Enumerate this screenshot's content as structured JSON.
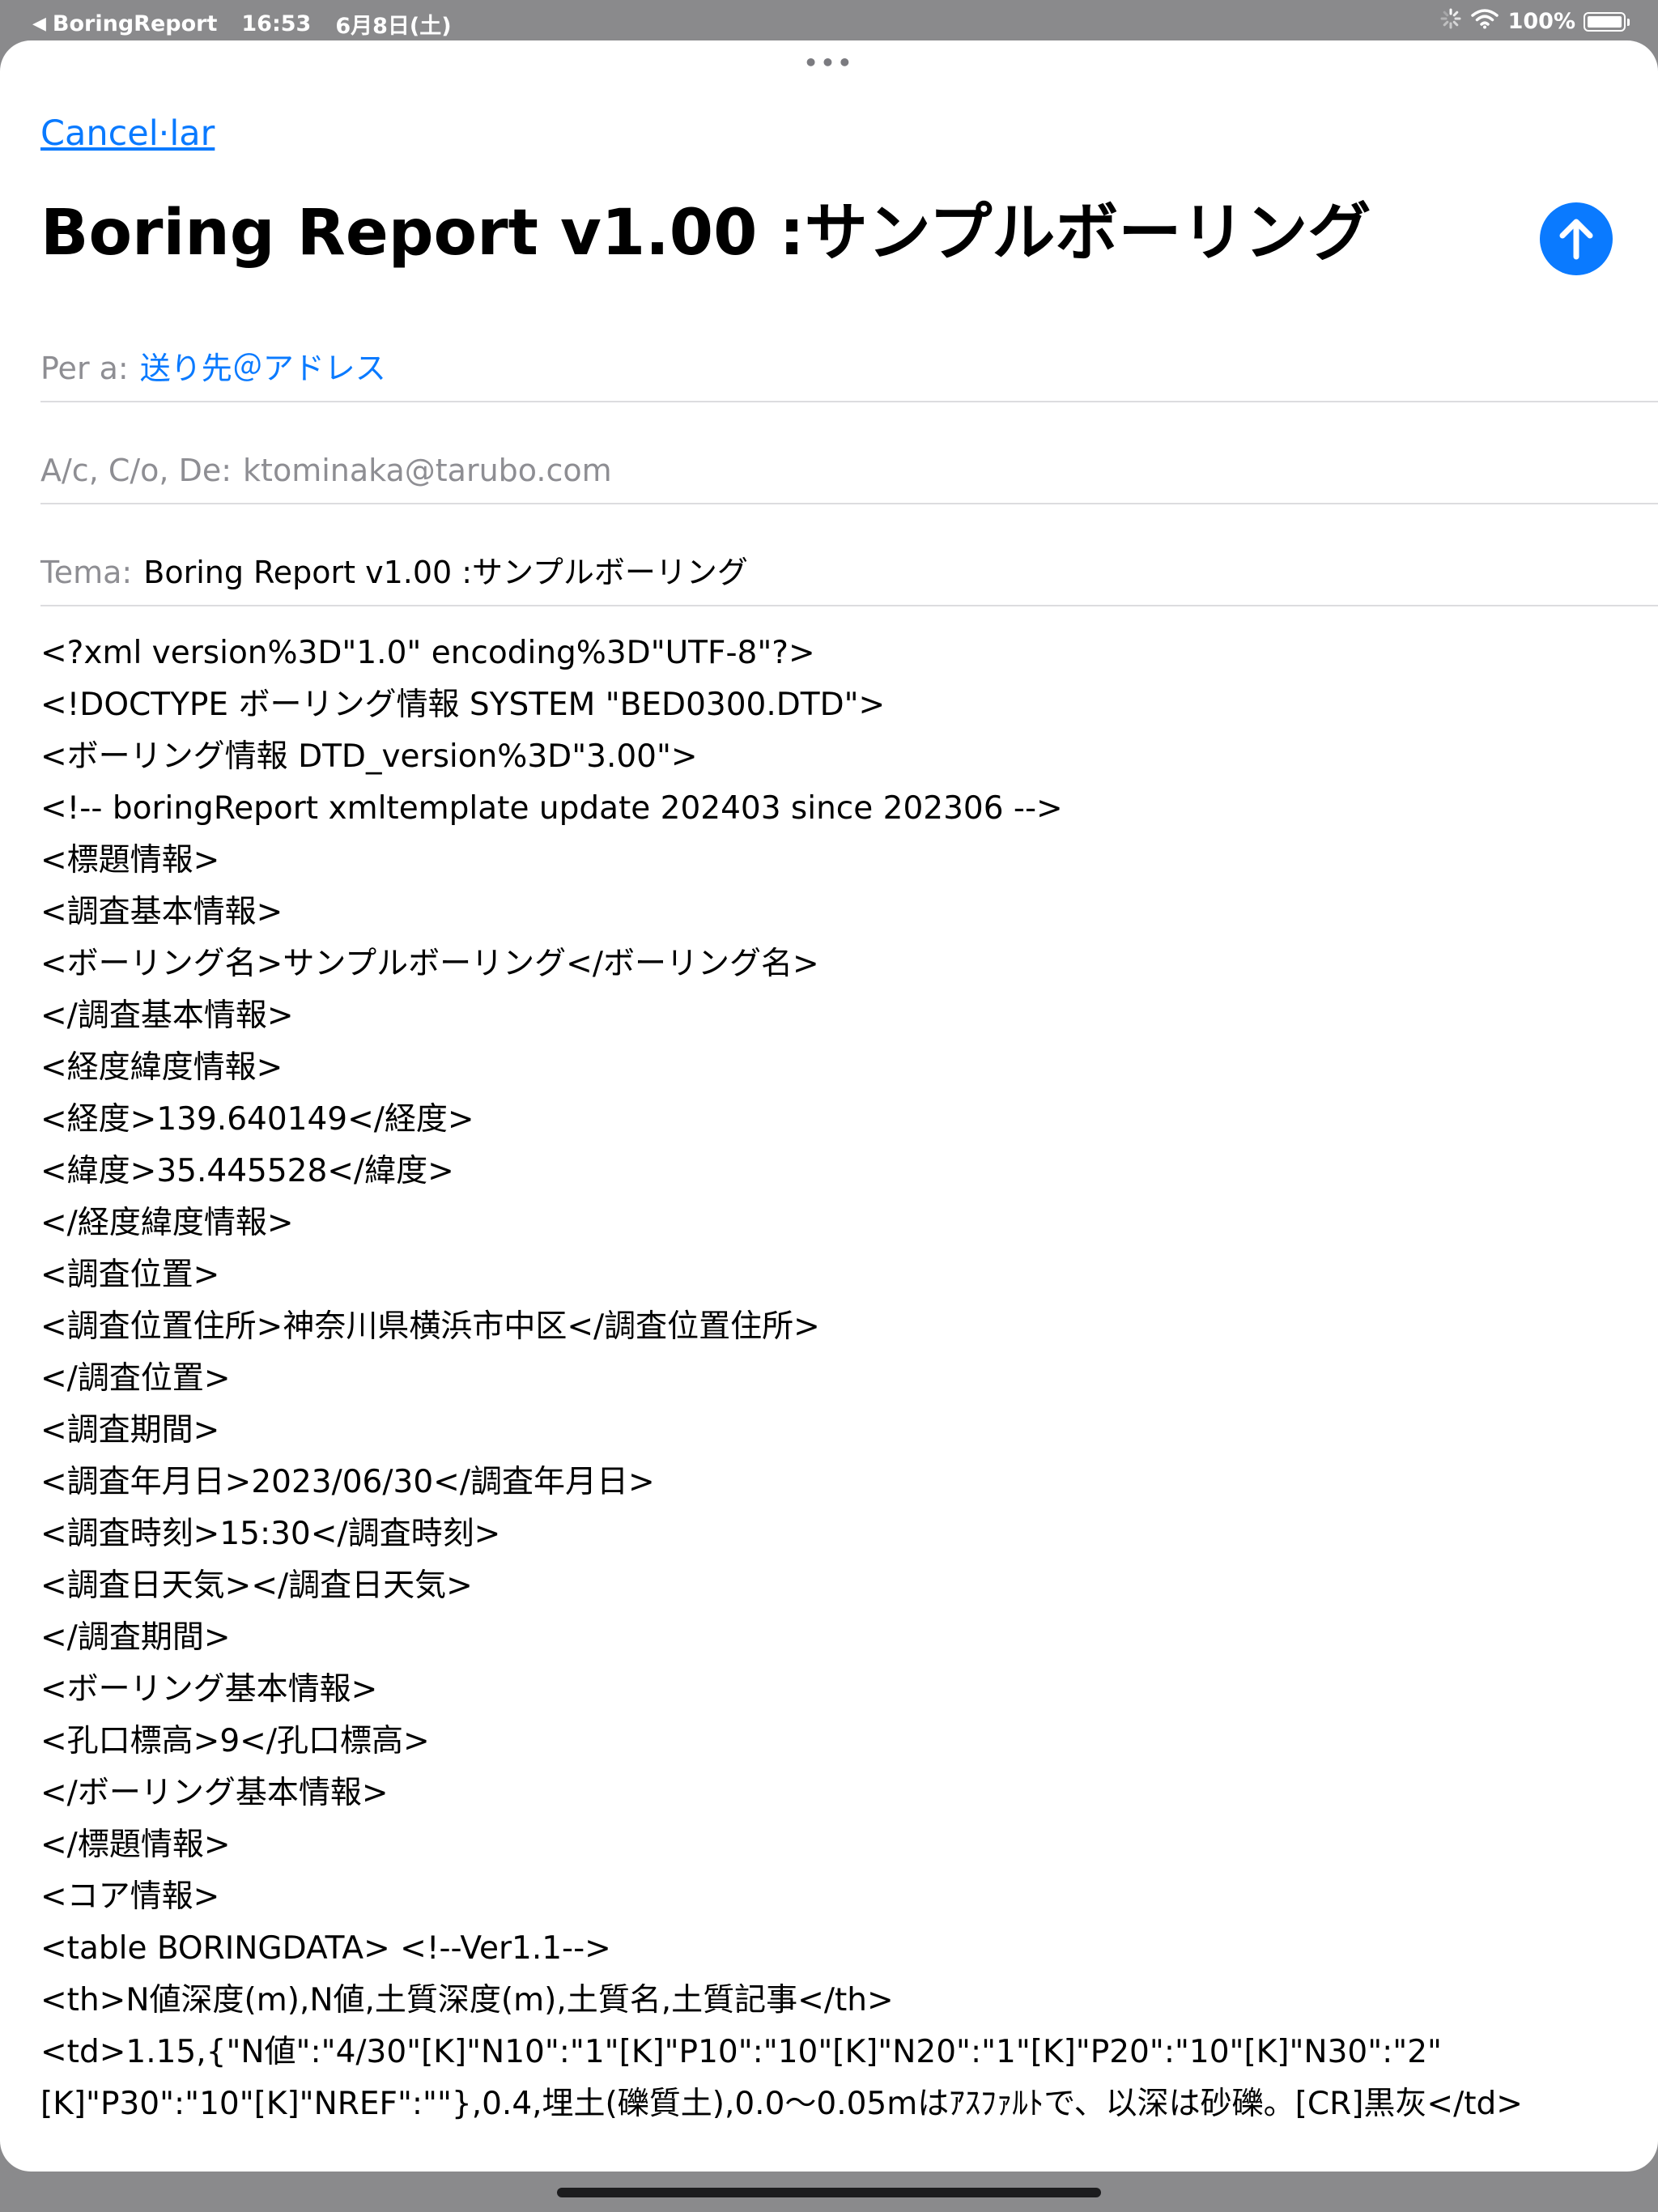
{
  "status_bar": {
    "back_app": "BoringReport",
    "time": "16:53",
    "date": "6月8日(土)",
    "battery": "100%"
  },
  "compose": {
    "cancel_label": "Cancel·lar",
    "title": "Boring Report v1.00 :サンプルボーリング",
    "to_label": "Per a:",
    "to_value": "送り先＠アドレス",
    "cc_label": "A/c, C/o, De:",
    "cc_value": "ktominaka@tarubo.com",
    "subject_label": "Tema:",
    "subject_value": "Boring Report v1.00 :サンプルボーリング"
  },
  "body_lines": [
    "<?xml version%3D\"1.0\" encoding%3D\"UTF-8\"?>",
    "<!DOCTYPE ボーリング情報 SYSTEM \"BED0300.DTD\">",
    "<ボーリング情報 DTD_version%3D\"3.00\">",
    "<!-- boringReport xmltemplate update 202403 since 202306 -->",
    "<標題情報>",
    "<調査基本情報>",
    "<ボーリング名>サンプルボーリング</ボーリング名>",
    "</調査基本情報>",
    "<経度緯度情報>",
    "<経度>139.640149</経度>",
    "<緯度>35.445528</緯度>",
    "</経度緯度情報>",
    "<調査位置>",
    "<調査位置住所>神奈川県横浜市中区</調査位置住所>",
    "</調査位置>",
    "<調査期間>",
    "<調査年月日>2023/06/30</調査年月日>",
    "<調査時刻>15:30</調査時刻>",
    "<調査日天気></調査日天気>",
    "</調査期間>",
    "<ボーリング基本情報>",
    "<孔口標高>9</孔口標高>",
    "</ボーリング基本情報>",
    "</標題情報>",
    "<コア情報>",
    "<table BORINGDATA> <!--Ver1.1-->",
    "<th>N値深度(m),N値,土質深度(m),土質名,土質記事</th>",
    "<td>1.15,{\"N値\":\"4/30\"[K]\"N10\":\"1\"[K]\"P10\":\"10\"[K]\"N20\":\"1\"[K]\"P20\":\"10\"[K]\"N30\":\"2\"[K]\"P30\":\"10\"[K]\"NREF\":\"\"},0.4,埋土(礫質土),0.0〜0.05mはｱｽﾌｧﾙﾄで、以深は砂礫。[CR]黒灰</td>"
  ]
}
